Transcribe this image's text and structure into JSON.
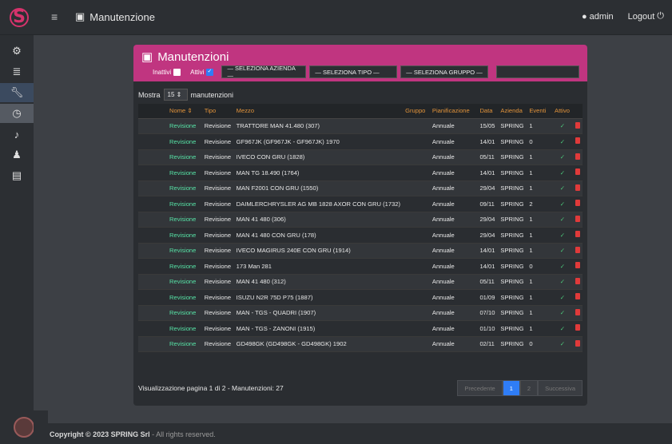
{
  "topbar": {
    "title": "Manutenzione",
    "user": "admin",
    "logout": "Logout"
  },
  "sidebar": {
    "items": [
      {
        "icon": "cogs-icon"
      },
      {
        "icon": "database-icon"
      },
      {
        "icon": "wrench-icon"
      },
      {
        "icon": "clock-icon"
      },
      {
        "icon": "bell-icon"
      },
      {
        "icon": "users-icon"
      },
      {
        "icon": "print-icon"
      }
    ]
  },
  "card": {
    "title": "Manutenzioni",
    "filters": {
      "inactive_label": "Inattivi",
      "active_label": "Attivi",
      "azienda": "— SELEZIONA AZIENDA —",
      "tipo": "— SELEZIONA TIPO —",
      "gruppo": "— SELEZIONA GRUPPO —",
      "search_placeholder": ""
    },
    "length": {
      "prefix": "Mostra",
      "value": "15",
      "suffix": "manutenzioni"
    },
    "columns": [
      "Nome",
      "Tipo",
      "Mezzo",
      "Gruppo",
      "Pianificazione",
      "Data",
      "Azienda",
      "Eventi",
      "Attivo",
      ""
    ],
    "rows": [
      {
        "nome": "Revisione",
        "tipo": "Revisione",
        "mezzo": "TRATTORE MAN 41.480 (307)",
        "gruppo": "",
        "pian": "Annuale",
        "data": "15/05",
        "azienda": "SPRING",
        "eventi": "1"
      },
      {
        "nome": "Revisione",
        "tipo": "Revisione",
        "mezzo": "GF967JK (GF967JK - GF967JK) 1970",
        "gruppo": "",
        "pian": "Annuale",
        "data": "14/01",
        "azienda": "SPRING",
        "eventi": "0"
      },
      {
        "nome": "Revisione",
        "tipo": "Revisione",
        "mezzo": "IVECO CON GRU (1828)",
        "gruppo": "",
        "pian": "Annuale",
        "data": "05/11",
        "azienda": "SPRING",
        "eventi": "1"
      },
      {
        "nome": "Revisione",
        "tipo": "Revisione",
        "mezzo": "MAN TG 18.490 (1764)",
        "gruppo": "",
        "pian": "Annuale",
        "data": "14/01",
        "azienda": "SPRING",
        "eventi": "1"
      },
      {
        "nome": "Revisione",
        "tipo": "Revisione",
        "mezzo": "MAN F2001 CON GRU (1550)",
        "gruppo": "",
        "pian": "Annuale",
        "data": "29/04",
        "azienda": "SPRING",
        "eventi": "1"
      },
      {
        "nome": "Revisione",
        "tipo": "Revisione",
        "mezzo": "DAIMLERCHRYSLER AG MB 1828 AXOR CON GRU (1732)",
        "gruppo": "",
        "pian": "Annuale",
        "data": "09/11",
        "azienda": "SPRING",
        "eventi": "2"
      },
      {
        "nome": "Revisione",
        "tipo": "Revisione",
        "mezzo": "MAN 41 480 (306)",
        "gruppo": "",
        "pian": "Annuale",
        "data": "29/04",
        "azienda": "SPRING",
        "eventi": "1"
      },
      {
        "nome": "Revisione",
        "tipo": "Revisione",
        "mezzo": "MAN 41 480 CON GRU (178)",
        "gruppo": "",
        "pian": "Annuale",
        "data": "29/04",
        "azienda": "SPRING",
        "eventi": "1"
      },
      {
        "nome": "Revisione",
        "tipo": "Revisione",
        "mezzo": "IVECO MAGIRUS 240E CON GRU (1914)",
        "gruppo": "",
        "pian": "Annuale",
        "data": "14/01",
        "azienda": "SPRING",
        "eventi": "1"
      },
      {
        "nome": "Revisione",
        "tipo": "Revisione",
        "mezzo": "173 Man 281",
        "gruppo": "",
        "pian": "Annuale",
        "data": "14/01",
        "azienda": "SPRING",
        "eventi": "0"
      },
      {
        "nome": "Revisione",
        "tipo": "Revisione",
        "mezzo": "MAN 41 480 (312)",
        "gruppo": "",
        "pian": "Annuale",
        "data": "05/11",
        "azienda": "SPRING",
        "eventi": "1"
      },
      {
        "nome": "Revisione",
        "tipo": "Revisione",
        "mezzo": "ISUZU N2R 75D P75 (1887)",
        "gruppo": "",
        "pian": "Annuale",
        "data": "01/09",
        "azienda": "SPRING",
        "eventi": "1"
      },
      {
        "nome": "Revisione",
        "tipo": "Revisione",
        "mezzo": "MAN - TGS - QUADRI (1907)",
        "gruppo": "",
        "pian": "Annuale",
        "data": "07/10",
        "azienda": "SPRING",
        "eventi": "1"
      },
      {
        "nome": "Revisione",
        "tipo": "Revisione",
        "mezzo": "MAN - TGS - ZANONI (1915)",
        "gruppo": "",
        "pian": "Annuale",
        "data": "01/10",
        "azienda": "SPRING",
        "eventi": "1"
      },
      {
        "nome": "Revisione",
        "tipo": "Revisione",
        "mezzo": "GD498GK (GD498GK - GD498GK) 1902",
        "gruppo": "",
        "pian": "Annuale",
        "data": "02/11",
        "azienda": "SPRING",
        "eventi": "0"
      }
    ],
    "info": "Visualizzazione pagina 1 di 2 - Manutenzioni: 27",
    "pager": {
      "prev": "Precedente",
      "page1": "1",
      "page2": "2",
      "next": "Successiva"
    }
  },
  "footer": {
    "copyright": "Copyright © 2023 SPRING Srl",
    "rights": " - All rights reserved."
  },
  "colors": {
    "accent": "#c03580",
    "link_green": "#57e3a6",
    "header_orange": "#e0923a",
    "primary_blue": "#2f7df6",
    "danger_red": "#e03a3a"
  }
}
